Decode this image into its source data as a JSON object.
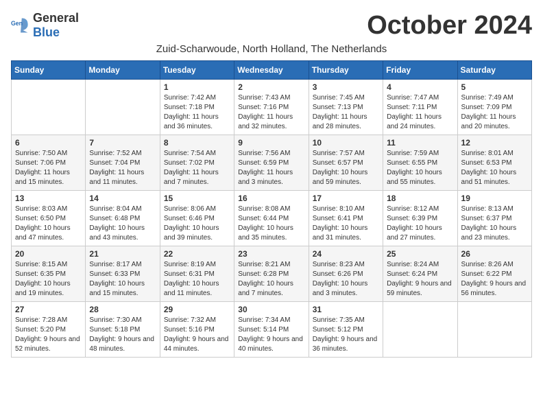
{
  "logo": {
    "general": "General",
    "blue": "Blue"
  },
  "title": "October 2024",
  "subtitle": "Zuid-Scharwoude, North Holland, The Netherlands",
  "days_of_week": [
    "Sunday",
    "Monday",
    "Tuesday",
    "Wednesday",
    "Thursday",
    "Friday",
    "Saturday"
  ],
  "weeks": [
    [
      {
        "day": "",
        "info": ""
      },
      {
        "day": "",
        "info": ""
      },
      {
        "day": "1",
        "info": "Sunrise: 7:42 AM\nSunset: 7:18 PM\nDaylight: 11 hours and 36 minutes."
      },
      {
        "day": "2",
        "info": "Sunrise: 7:43 AM\nSunset: 7:16 PM\nDaylight: 11 hours and 32 minutes."
      },
      {
        "day": "3",
        "info": "Sunrise: 7:45 AM\nSunset: 7:13 PM\nDaylight: 11 hours and 28 minutes."
      },
      {
        "day": "4",
        "info": "Sunrise: 7:47 AM\nSunset: 7:11 PM\nDaylight: 11 hours and 24 minutes."
      },
      {
        "day": "5",
        "info": "Sunrise: 7:49 AM\nSunset: 7:09 PM\nDaylight: 11 hours and 20 minutes."
      }
    ],
    [
      {
        "day": "6",
        "info": "Sunrise: 7:50 AM\nSunset: 7:06 PM\nDaylight: 11 hours and 15 minutes."
      },
      {
        "day": "7",
        "info": "Sunrise: 7:52 AM\nSunset: 7:04 PM\nDaylight: 11 hours and 11 minutes."
      },
      {
        "day": "8",
        "info": "Sunrise: 7:54 AM\nSunset: 7:02 PM\nDaylight: 11 hours and 7 minutes."
      },
      {
        "day": "9",
        "info": "Sunrise: 7:56 AM\nSunset: 6:59 PM\nDaylight: 11 hours and 3 minutes."
      },
      {
        "day": "10",
        "info": "Sunrise: 7:57 AM\nSunset: 6:57 PM\nDaylight: 10 hours and 59 minutes."
      },
      {
        "day": "11",
        "info": "Sunrise: 7:59 AM\nSunset: 6:55 PM\nDaylight: 10 hours and 55 minutes."
      },
      {
        "day": "12",
        "info": "Sunrise: 8:01 AM\nSunset: 6:53 PM\nDaylight: 10 hours and 51 minutes."
      }
    ],
    [
      {
        "day": "13",
        "info": "Sunrise: 8:03 AM\nSunset: 6:50 PM\nDaylight: 10 hours and 47 minutes."
      },
      {
        "day": "14",
        "info": "Sunrise: 8:04 AM\nSunset: 6:48 PM\nDaylight: 10 hours and 43 minutes."
      },
      {
        "day": "15",
        "info": "Sunrise: 8:06 AM\nSunset: 6:46 PM\nDaylight: 10 hours and 39 minutes."
      },
      {
        "day": "16",
        "info": "Sunrise: 8:08 AM\nSunset: 6:44 PM\nDaylight: 10 hours and 35 minutes."
      },
      {
        "day": "17",
        "info": "Sunrise: 8:10 AM\nSunset: 6:41 PM\nDaylight: 10 hours and 31 minutes."
      },
      {
        "day": "18",
        "info": "Sunrise: 8:12 AM\nSunset: 6:39 PM\nDaylight: 10 hours and 27 minutes."
      },
      {
        "day": "19",
        "info": "Sunrise: 8:13 AM\nSunset: 6:37 PM\nDaylight: 10 hours and 23 minutes."
      }
    ],
    [
      {
        "day": "20",
        "info": "Sunrise: 8:15 AM\nSunset: 6:35 PM\nDaylight: 10 hours and 19 minutes."
      },
      {
        "day": "21",
        "info": "Sunrise: 8:17 AM\nSunset: 6:33 PM\nDaylight: 10 hours and 15 minutes."
      },
      {
        "day": "22",
        "info": "Sunrise: 8:19 AM\nSunset: 6:31 PM\nDaylight: 10 hours and 11 minutes."
      },
      {
        "day": "23",
        "info": "Sunrise: 8:21 AM\nSunset: 6:28 PM\nDaylight: 10 hours and 7 minutes."
      },
      {
        "day": "24",
        "info": "Sunrise: 8:23 AM\nSunset: 6:26 PM\nDaylight: 10 hours and 3 minutes."
      },
      {
        "day": "25",
        "info": "Sunrise: 8:24 AM\nSunset: 6:24 PM\nDaylight: 9 hours and 59 minutes."
      },
      {
        "day": "26",
        "info": "Sunrise: 8:26 AM\nSunset: 6:22 PM\nDaylight: 9 hours and 56 minutes."
      }
    ],
    [
      {
        "day": "27",
        "info": "Sunrise: 7:28 AM\nSunset: 5:20 PM\nDaylight: 9 hours and 52 minutes."
      },
      {
        "day": "28",
        "info": "Sunrise: 7:30 AM\nSunset: 5:18 PM\nDaylight: 9 hours and 48 minutes."
      },
      {
        "day": "29",
        "info": "Sunrise: 7:32 AM\nSunset: 5:16 PM\nDaylight: 9 hours and 44 minutes."
      },
      {
        "day": "30",
        "info": "Sunrise: 7:34 AM\nSunset: 5:14 PM\nDaylight: 9 hours and 40 minutes."
      },
      {
        "day": "31",
        "info": "Sunrise: 7:35 AM\nSunset: 5:12 PM\nDaylight: 9 hours and 36 minutes."
      },
      {
        "day": "",
        "info": ""
      },
      {
        "day": "",
        "info": ""
      }
    ]
  ]
}
